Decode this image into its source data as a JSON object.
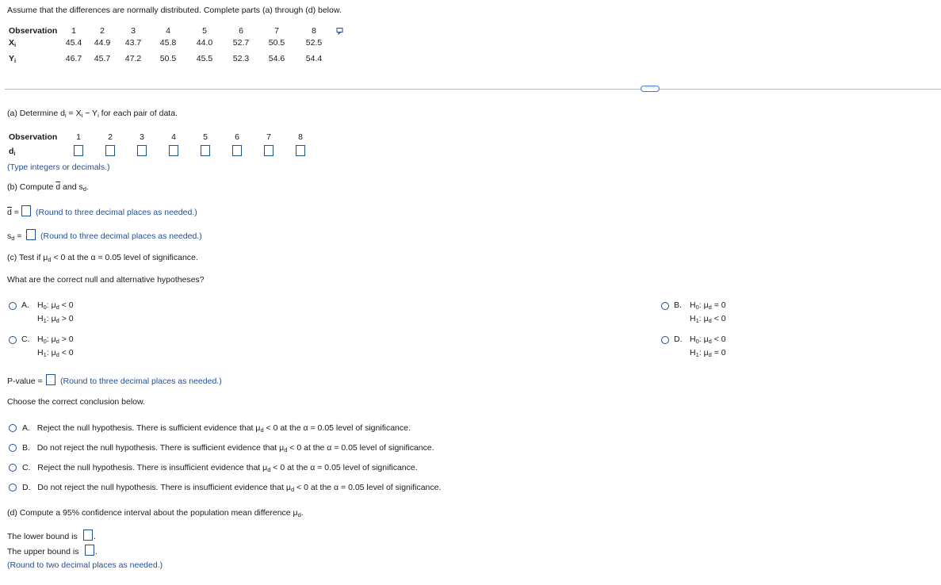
{
  "intro": "Assume that the differences are normally distributed. Complete parts (a) through (d) below.",
  "table": {
    "row_label_obs": "Observation",
    "row_label_x": "X",
    "row_label_y": "Y",
    "sub_i": "i",
    "observations": [
      "1",
      "2",
      "3",
      "4",
      "5",
      "6",
      "7",
      "8"
    ],
    "x": [
      "45.4",
      "44.9",
      "43.7",
      "45.8",
      "44.0",
      "52.7",
      "50.5",
      "52.5"
    ],
    "y": [
      "46.7",
      "45.7",
      "47.2",
      "50.5",
      "45.5",
      "52.3",
      "54.6",
      "54.4"
    ]
  },
  "more_label": "·····",
  "part_a": {
    "pre": "(a) Determine d",
    "sub_i": "i",
    "mid": " = X",
    "mid2": " − Y",
    "post": " for each pair of data.",
    "obs_label": "Observation",
    "d_label": "d",
    "hint": "(Type integers or decimals.)"
  },
  "part_b": {
    "pre": "(b) Compute ",
    "dbar": "d",
    "and": " and s",
    "sub_d": "d",
    "post": ".",
    "dbar_eq": " =",
    "sd_label": "s",
    "sd_eq": " =",
    "round_hint": "(Round to three decimal places as needed.)"
  },
  "part_c": {
    "pre": "(c) Test if μ",
    "sub_d": "d",
    "post": " < 0 at the α = 0.05 level of significance.",
    "question": "What are the correct null and alternative hypotheses?",
    "options": [
      {
        "letter": "A.",
        "h0": "μ",
        "h0rel": " < 0",
        "h1": "μ",
        "h1rel": " > 0"
      },
      {
        "letter": "B.",
        "h0": "μ",
        "h0rel": " = 0",
        "h1": "μ",
        "h1rel": " < 0"
      },
      {
        "letter": "C.",
        "h0": "μ",
        "h0rel": " > 0",
        "h1": "μ",
        "h1rel": " < 0"
      },
      {
        "letter": "D.",
        "h0": "μ",
        "h0rel": " < 0",
        "h1": "μ",
        "h1rel": " = 0"
      }
    ],
    "h0_prefix": "H",
    "h0_sub": "0",
    "h1_prefix": "H",
    "h1_sub": "1",
    "colon": ": ",
    "pvalue_label": "P-value =",
    "pvalue_hint": "(Round to three decimal places as needed.)",
    "conclusion_prompt": "Choose the correct conclusion below.",
    "conclusions": [
      {
        "letter": "A.",
        "pre": "Reject the null hypothesis. There is sufficient evidence that μ",
        "post": " < 0 at the α = 0.05 level of significance."
      },
      {
        "letter": "B.",
        "pre": "Do not reject the null hypothesis. There is sufficient evidence that μ",
        "post": " < 0 at the α = 0.05 level of significance."
      },
      {
        "letter": "C.",
        "pre": "Reject the null hypothesis. There is insufficient evidence that μ",
        "post": " < 0 at the α = 0.05 level of significance."
      },
      {
        "letter": "D.",
        "pre": "Do not reject the null hypothesis. There is insufficient evidence that μ",
        "post": " < 0 at the α = 0.05 level of significance."
      }
    ]
  },
  "part_d": {
    "pre": "(d) Compute a 95% confidence interval about the population mean difference μ",
    "sub_d": "d",
    "post": ".",
    "lower_label": "The lower bound is",
    "upper_label": "The upper bound is",
    "period": ".",
    "round_hint": "(Round to two decimal places as needed.)"
  },
  "colors": {
    "accent": "#1f4e9b",
    "divider": "#b9b9b9"
  }
}
